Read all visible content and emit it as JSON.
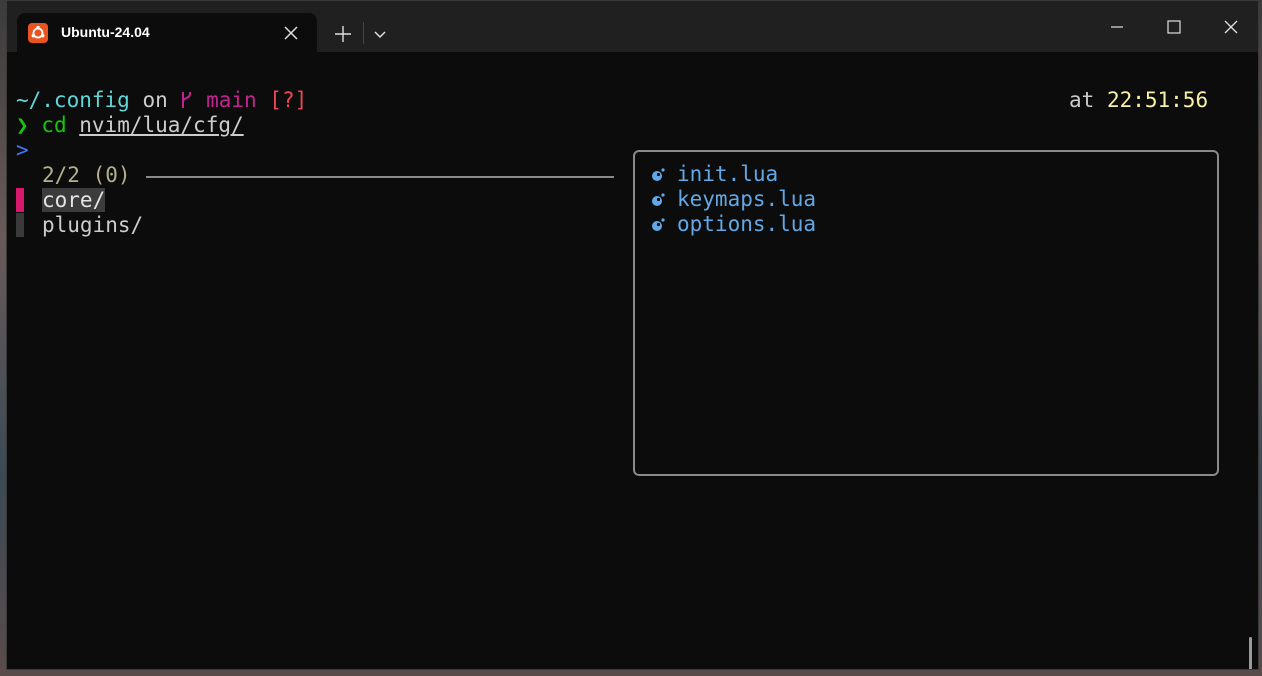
{
  "window": {
    "tab_title": "Ubuntu-24.04",
    "icons": {
      "tab": "ubuntu-icon",
      "close_tab": "close-icon",
      "new_tab": "plus-icon",
      "dropdown": "chevron-down-icon",
      "minimize": "minimize-icon",
      "maximize": "maximize-icon",
      "close_window": "close-icon"
    }
  },
  "prompt": {
    "path": "~/.config",
    "on": "on",
    "branch_icon": "git-branch-icon",
    "branch": "main",
    "status": "[?]",
    "at": "at",
    "time": "22:51:56",
    "chevron": "❯",
    "command": "cd",
    "argument": "nvim/lua/cfg/"
  },
  "picker": {
    "input_prompt": ">",
    "count": "2/2 (0)",
    "items": [
      {
        "label": "core/",
        "selected": true
      },
      {
        "label": "plugins/",
        "selected": false
      }
    ]
  },
  "preview": {
    "files": [
      "init.lua",
      "keymaps.lua",
      "options.lua"
    ],
    "file_icon": "lua-icon"
  },
  "colors": {
    "background": "#0c0c0c",
    "path": "#61d6d6",
    "branch": "#c2248f",
    "status": "#e74856",
    "prompt_chevron": "#16c60c",
    "time": "#f9f1a5",
    "selection_marker": "#d7186b",
    "file": "#62a8e6"
  }
}
